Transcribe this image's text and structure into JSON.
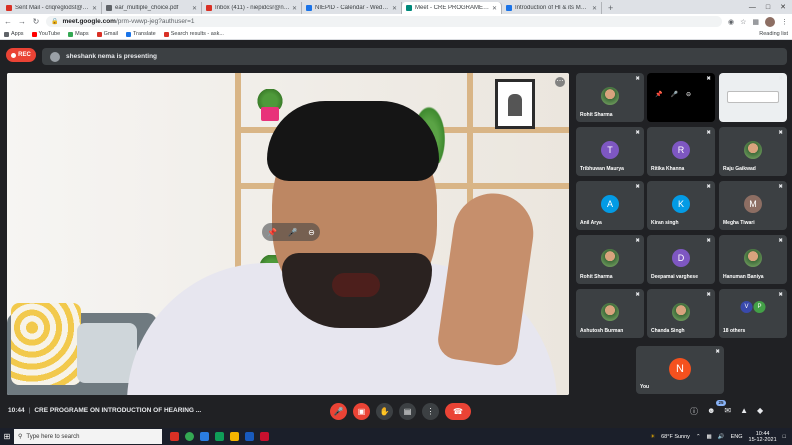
{
  "browser": {
    "tabs": [
      {
        "label": "Sent Mail - criqreglodst@gmail...",
        "color": "#d93025"
      },
      {
        "label": "ear_multiple_choice.pdf",
        "color": "#5f6368"
      },
      {
        "label": "Inbox (411) - niepidcsr@niepid...",
        "color": "#d93025"
      },
      {
        "label": "NIEPID - Calendar - Wednesday...",
        "color": "#1a73e8"
      },
      {
        "label": "Meet - CRE PROGRAME ON...",
        "color": "#00897b"
      },
      {
        "label": "Introduction of HI & its Manage...",
        "color": "#1a73e8"
      }
    ],
    "new_tab": "+",
    "url_host": "meet.google.com",
    "url_path": "/prm-vwwp-jeg?authuser=1",
    "bookmarks": [
      {
        "label": "Apps",
        "color": "#5f6368"
      },
      {
        "label": "YouTube",
        "color": "#ff0000"
      },
      {
        "label": "Maps",
        "color": "#34a853"
      },
      {
        "label": "Gmail",
        "color": "#d93025"
      },
      {
        "label": "Translate",
        "color": "#1a73e8"
      },
      {
        "label": "Search results - ask...",
        "color": "#d93025"
      }
    ],
    "reading_list": "Reading list"
  },
  "meet": {
    "rec_label": "REC",
    "presenting": "sheshank nema is presenting",
    "tiles": [
      {
        "name": "Rohit Sharma",
        "type": "photo"
      },
      {
        "name": "",
        "type": "black"
      },
      {
        "name": "",
        "type": "light"
      },
      {
        "name": "Tribhuwan Maurya",
        "initial": "T",
        "color": "#7e57c2"
      },
      {
        "name": "Ritika Khanna",
        "initial": "R",
        "color": "#7e57c2"
      },
      {
        "name": "Raju Gaikwad",
        "type": "photo"
      },
      {
        "name": "Anil Arya",
        "initial": "A",
        "color": "#039be5"
      },
      {
        "name": "Kiran singh",
        "initial": "K",
        "color": "#039be5"
      },
      {
        "name": "Megha Tiwari",
        "initial": "M",
        "color": "#8d6e63"
      },
      {
        "name": "Rohit Sharma",
        "type": "photo"
      },
      {
        "name": "Deepamai varghese",
        "initial": "D",
        "color": "#7e57c2"
      },
      {
        "name": "Hanuman Baniya",
        "type": "photo"
      },
      {
        "name": "Ashutosh Burman",
        "type": "photo"
      },
      {
        "name": "Chanda Singh",
        "type": "photo"
      },
      {
        "name": "18 others",
        "type": "others"
      }
    ],
    "others_initials": [
      "V",
      "P"
    ],
    "you": {
      "name": "You",
      "initial": "N"
    },
    "time": "10:44",
    "meeting_title": "CRE PROGRAME ON INTRODUCTION OF HEARING ...",
    "participants_badge": "25"
  },
  "taskbar": {
    "search_placeholder": "Type here to search",
    "weather": "68°F  Sunny",
    "lang": "ENG",
    "clock_time": "10:44",
    "clock_date": "15-12-2021"
  }
}
